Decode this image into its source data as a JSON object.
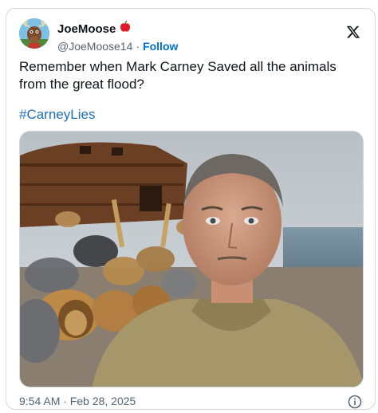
{
  "author": {
    "display_name": "JoeMoose",
    "handle": "@JoeMoose14",
    "separator": "·",
    "follow_label": "Follow",
    "badge_icon": "apple-icon",
    "avatar_icon": "moose-avatar-icon"
  },
  "tweet": {
    "text": "Remember when Mark Carney Saved all the animals from the great flood?",
    "hashtag": "#CarneyLies",
    "timestamp": "9:54 AM · Feb 28, 2025",
    "media_description_icon": "photo-icon"
  },
  "icons": {
    "platform_logo": "x-logo-icon",
    "info": "info-icon"
  },
  "colors": {
    "link": "#1d6fb8",
    "follow": "#006fd6",
    "secondary_text": "#536471",
    "border": "#cfd9de"
  }
}
